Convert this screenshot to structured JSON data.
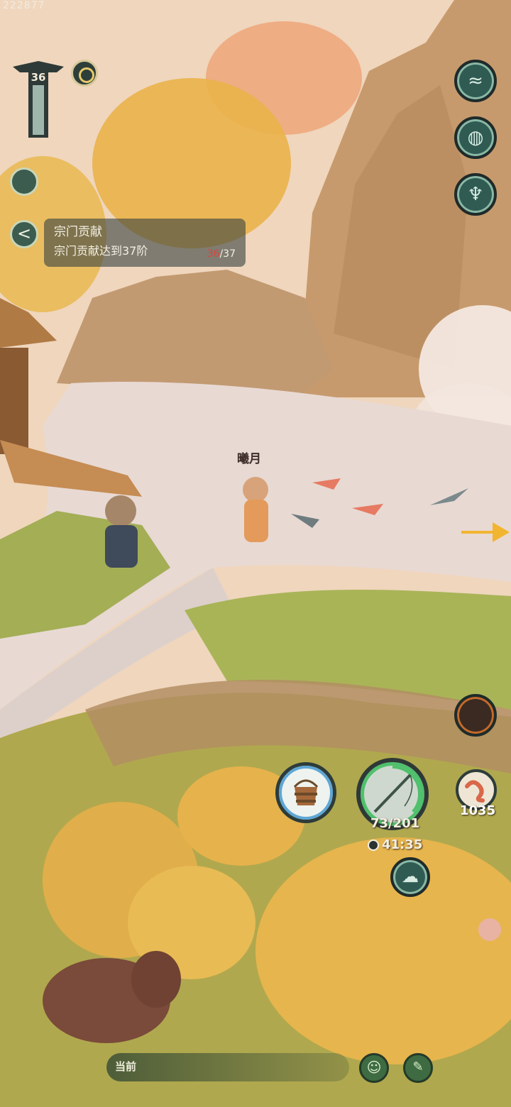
{
  "top": {
    "id_text": "222877",
    "level": "36"
  },
  "quest": {
    "title": "宗门贡献",
    "desc": "宗门贡献达到37阶",
    "progress_current": "36",
    "progress_total": "/37",
    "back_glyph": "<"
  },
  "npc": {
    "name": "曦月"
  },
  "fishing": {
    "durability": "73/201",
    "durability_fraction": 0.363,
    "timer": "41:35"
  },
  "bait": {
    "count": "1035"
  },
  "chat": {
    "label": "当前"
  },
  "icons": {
    "right_column": [
      "wave-icon",
      "pot-icon",
      "demon-mask-icon"
    ],
    "bucket": "bucket-icon",
    "rod": "fishing-rod-icon",
    "bait": "worm-icon",
    "swirl": "cloud-swirl-icon",
    "emoji": "smile-icon",
    "chat": "chat-icon"
  },
  "colors": {
    "accent_green": "#4fc06c",
    "bucket_ring": "#5ea7d6",
    "progress_red": "#d9463b"
  }
}
